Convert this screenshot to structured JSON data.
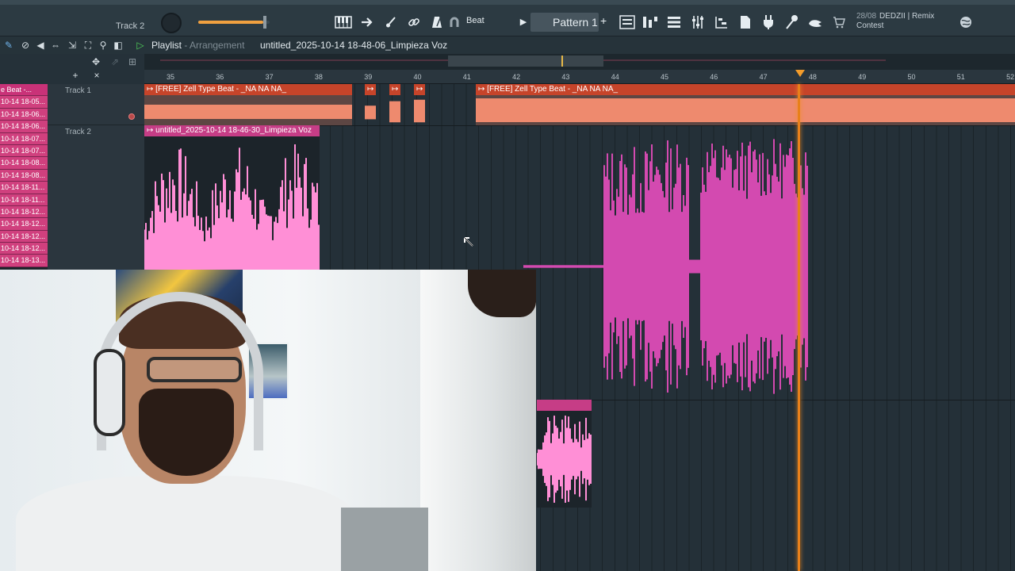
{
  "topbar": {
    "track_indicator": "Track 2",
    "volume_level": 0.95,
    "mode_label": "Beat",
    "pattern_label": "Pattern 1",
    "pattern_add": "+",
    "news_date": "28/08",
    "news_text": "DEDZII | Remix Contest",
    "icons": [
      "piano-keys-icon",
      "arrow-right-icon",
      "brush-icon",
      "link-icon",
      "metronome-icon",
      "magnet-icon",
      "channel-rack-icon",
      "step-sequencer-icon",
      "mixer-icon",
      "piano-roll-icon",
      "browser-icon",
      "plugin-icon",
      "microphone-icon",
      "hand-icon",
      "cart-icon",
      "globe-icon"
    ],
    "accent": "#f0a040"
  },
  "playlist": {
    "title": "Playlist",
    "mode": "Arrangement",
    "separator": " - ",
    "project_name": "untitled_2025-10-14 18-48-06_Limpieza Voz",
    "header_icons": [
      "draw-icon",
      "delete-icon",
      "mute-icon",
      "slip-icon",
      "select-icon",
      "zoom-icon",
      "playback-icon",
      "play-icon"
    ]
  },
  "ruler": {
    "bars": [
      "35",
      "36",
      "37",
      "38",
      "39",
      "40",
      "41",
      "42",
      "43",
      "44",
      "45",
      "46",
      "47",
      "48",
      "49",
      "50",
      "51",
      "52"
    ]
  },
  "picker": {
    "items": [
      "e Beat -...",
      "10-14 18-05...",
      "10-14 18-06...",
      "10-14 18-06...",
      "10-14 18-07...",
      "10-14 18-07...",
      "10-14 18-08...",
      "10-14 18-08...",
      "10-14 18-11...",
      "10-14 18-11...",
      "10-14 18-12...",
      "10-14 18-12...",
      "10-14 18-12...",
      "10-14 18-12...",
      "10-14 18-13..."
    ]
  },
  "tracks": [
    {
      "name": "Track 1"
    },
    {
      "name": "Track 2"
    }
  ],
  "clips": {
    "track1_a": "[FREE] Zell Type Beat - _NA NA NA_",
    "track1_b": "[FREE] Zell Type Beat - _NA NA NA_",
    "track2_a": "untitled_2025-10-14 18-46-30_Limpieza Voz",
    "small_marker": "↦"
  },
  "colors": {
    "clip_orange": "#ee8a6e",
    "clip_orange_label": "#c6442a",
    "clip_pink": "#c63d86",
    "wave_pink": "#ff8fd6",
    "wave_magenta": "#d34ab0",
    "playhead": "#e8801a"
  }
}
